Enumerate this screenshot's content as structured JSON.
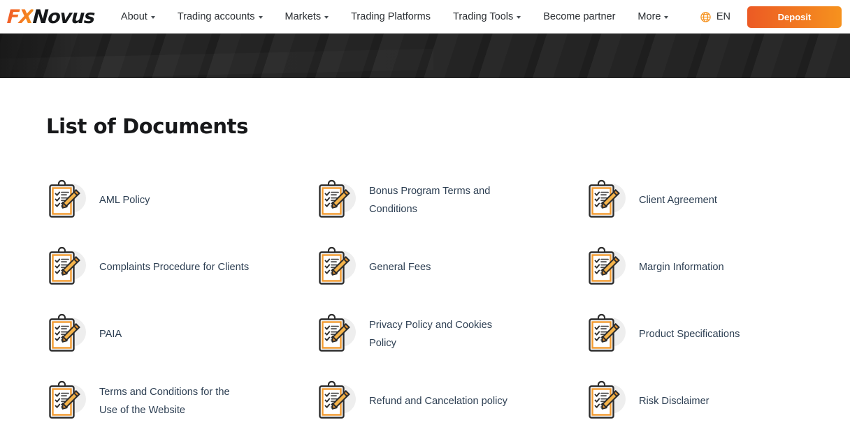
{
  "header": {
    "logo": {
      "part1": "FX",
      "part2": "Novus",
      "name": "FXNovus"
    },
    "nav": [
      {
        "label": "About",
        "has_caret": true
      },
      {
        "label": "Trading accounts",
        "has_caret": true
      },
      {
        "label": "Markets",
        "has_caret": true
      },
      {
        "label": "Trading Platforms",
        "has_caret": false
      },
      {
        "label": "Trading Tools",
        "has_caret": true
      },
      {
        "label": "Become partner",
        "has_caret": false
      },
      {
        "label": "More",
        "has_caret": true
      }
    ],
    "language": {
      "label": "EN",
      "icon": "globe-icon"
    },
    "deposit_label": "Deposit"
  },
  "colors": {
    "accent_orange": "#f0592a",
    "accent_orange_light": "#f6921e",
    "hero_dark": "#242424",
    "text_dark": "#17181a",
    "link_slate": "#2c3e52"
  },
  "main": {
    "title": "List of Documents",
    "documents": [
      {
        "label": "AML Policy"
      },
      {
        "label": "Bonus Program Terms and Conditions"
      },
      {
        "label": "Client Agreement"
      },
      {
        "label": "Complaints Procedure for Clients"
      },
      {
        "label": "General Fees"
      },
      {
        "label": "Margin Information"
      },
      {
        "label": "PAIA"
      },
      {
        "label": "Privacy Policy and Cookies Policy"
      },
      {
        "label": "Product Specifications"
      },
      {
        "label": "Terms and Conditions for the Use of the Website"
      },
      {
        "label": "Refund and Cancelation policy"
      },
      {
        "label": "Risk Disclaimer"
      }
    ]
  }
}
